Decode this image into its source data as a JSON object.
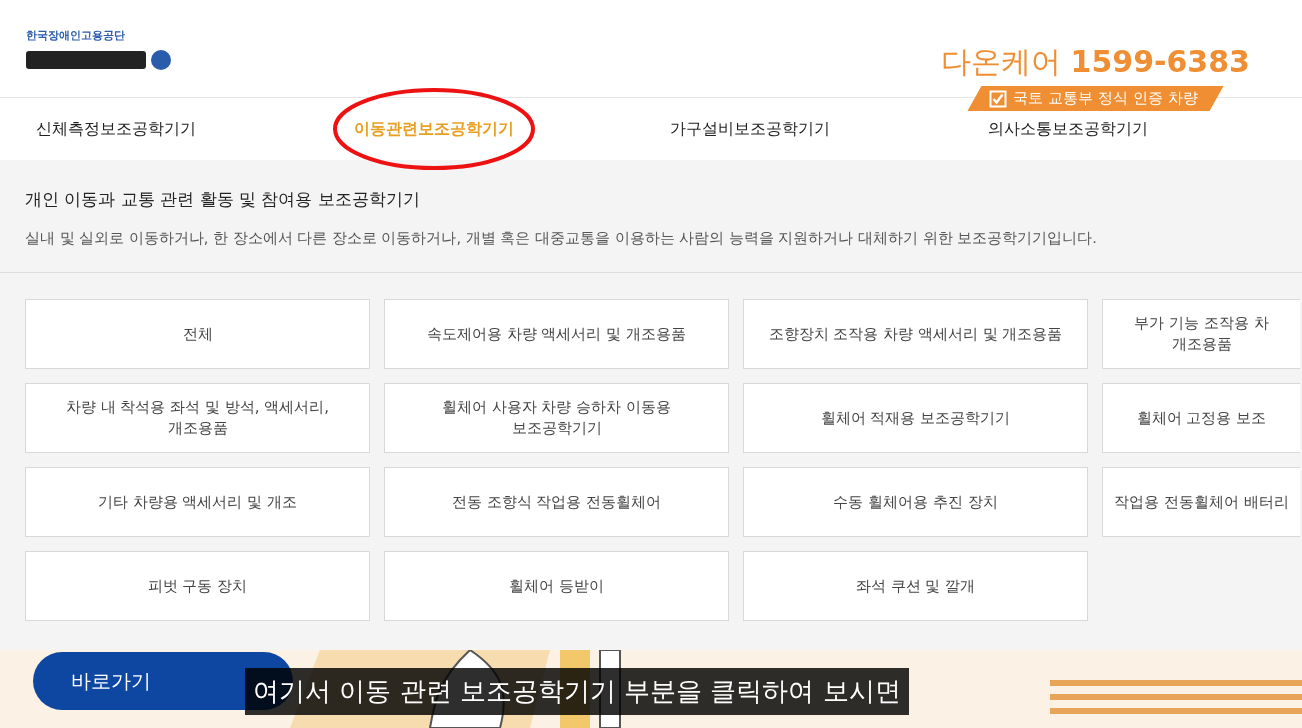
{
  "logo": {
    "org_name": "한국장애인고용공단"
  },
  "hotline": {
    "brand": "다온케어",
    "phone": "1599-6383",
    "badge": "국토 교통부 정식 인증 차량",
    "badge_checked": true
  },
  "tabs": [
    {
      "label": "신체측정보조공학기기",
      "selected": false,
      "circled": false
    },
    {
      "label": "이동관련보조공학기기",
      "selected": true,
      "circled": true
    },
    {
      "label": "가구설비보조공학기기",
      "selected": false,
      "circled": false
    },
    {
      "label": "의사소통보조공학기기",
      "selected": false,
      "circled": false
    }
  ],
  "category": {
    "title": "개인 이동과 교통 관련 활동 및 참여용 보조공학기기",
    "description": "실내 및 실외로 이동하거나, 한 장소에서 다른 장소로 이동하거나, 개별 혹은 대중교통을 이용하는 사람의 능력을 지원하거나 대체하기 위한 보조공학기기입니다."
  },
  "subcategories": [
    {
      "label": "전체"
    },
    {
      "label": "속도제어용 차량 액세서리 및 개조용품"
    },
    {
      "label": "조향장치 조작용 차량 액세서리 및 개조용품"
    },
    {
      "label": "부가 기능 조작용 차\n개조용품"
    },
    {
      "label": "차량 내 착석용 좌석 및 방석, 액세서리,\n개조용품"
    },
    {
      "label": "휠체어 사용자 차량 승하차 이동용\n보조공학기기"
    },
    {
      "label": "휠체어 적재용 보조공학기기"
    },
    {
      "label": "휠체어 고정용 보조"
    },
    {
      "label": "기타 차량용 액세서리 및 개조"
    },
    {
      "label": "전동 조향식 작업용 전동휠체어"
    },
    {
      "label": "수동 휠체어용 추진 장치"
    },
    {
      "label": "작업용 전동휠체어 배터리"
    },
    {
      "label": "피벗 구동 장치"
    },
    {
      "label": "휠체어 등받이"
    },
    {
      "label": "좌석 쿠션 및 깔개"
    }
  ],
  "shortcut_button": "바로가기",
  "subtitle": "여기서 이동 관련 보조공학기기 부분을 클릭하여 보시면"
}
